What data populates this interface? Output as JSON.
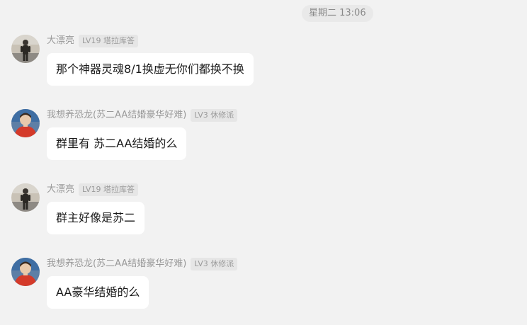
{
  "timestamp": "星期二 13:06",
  "messages": [
    {
      "sender": "大漂亮",
      "badge": "LV19 塔拉库答",
      "text": "那个神器灵魂8/1换虚无你们都换不换",
      "avatar": "avatar-person-standing"
    },
    {
      "sender": "我想养恐龙(苏二AA结婚豪华好难)",
      "badge": "LV3 休修派",
      "text": "群里有 苏二AA结婚的么",
      "avatar": "avatar-person-red"
    },
    {
      "sender": "大漂亮",
      "badge": "LV19 塔拉库答",
      "text": "群主好像是苏二",
      "avatar": "avatar-person-standing"
    },
    {
      "sender": "我想养恐龙(苏二AA结婚豪华好难)",
      "badge": "LV3 休修派",
      "text": "AA豪华结婚的么",
      "avatar": "avatar-person-red"
    }
  ],
  "colors": {
    "background": "#f2f2f2",
    "bubble": "#ffffff",
    "name_text": "#999999",
    "badge_bg": "#e6e6e6",
    "message_text": "#1a1a1a"
  }
}
